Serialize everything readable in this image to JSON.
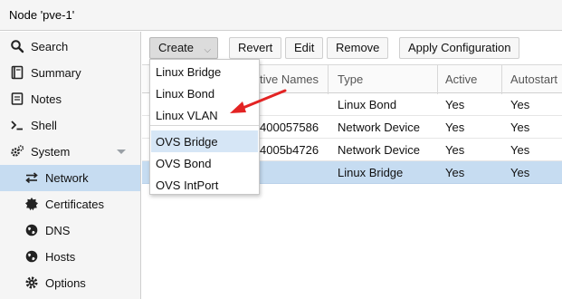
{
  "header": {
    "title": "Node 'pve-1'"
  },
  "sidebar": {
    "items": [
      {
        "label": "Search",
        "icon": "search-icon"
      },
      {
        "label": "Summary",
        "icon": "book-icon"
      },
      {
        "label": "Notes",
        "icon": "note-icon"
      },
      {
        "label": "Shell",
        "icon": "terminal-icon"
      },
      {
        "label": "System",
        "icon": "cogs-icon"
      },
      {
        "label": "Network",
        "icon": "exchange-icon"
      },
      {
        "label": "Certificates",
        "icon": "certificate-icon"
      },
      {
        "label": "DNS",
        "icon": "globe-icon"
      },
      {
        "label": "Hosts",
        "icon": "globe-icon"
      },
      {
        "label": "Options",
        "icon": "gear-icon"
      }
    ]
  },
  "toolbar": {
    "create": "Create",
    "revert": "Revert",
    "edit": "Edit",
    "remove": "Remove",
    "apply": "Apply Configuration"
  },
  "grid": {
    "columns": [
      "tive Names",
      "Type",
      "Active",
      "Autostart"
    ],
    "rows": [
      {
        "names": "",
        "type": "Linux Bond",
        "active": "Yes",
        "autostart": "Yes"
      },
      {
        "names": "400057586",
        "type": "Network Device",
        "active": "Yes",
        "autostart": "Yes"
      },
      {
        "names": "4005b4726",
        "type": "Network Device",
        "active": "Yes",
        "autostart": "Yes"
      },
      {
        "names": "",
        "type": "Linux Bridge",
        "active": "Yes",
        "autostart": "Yes"
      }
    ]
  },
  "menu": {
    "items": [
      "Linux Bridge",
      "Linux Bond",
      "Linux VLAN",
      "OVS Bridge",
      "OVS Bond",
      "OVS IntPort"
    ]
  },
  "colors": {
    "selection": "#c6dcf1",
    "annotation_arrow": "#e32323"
  }
}
